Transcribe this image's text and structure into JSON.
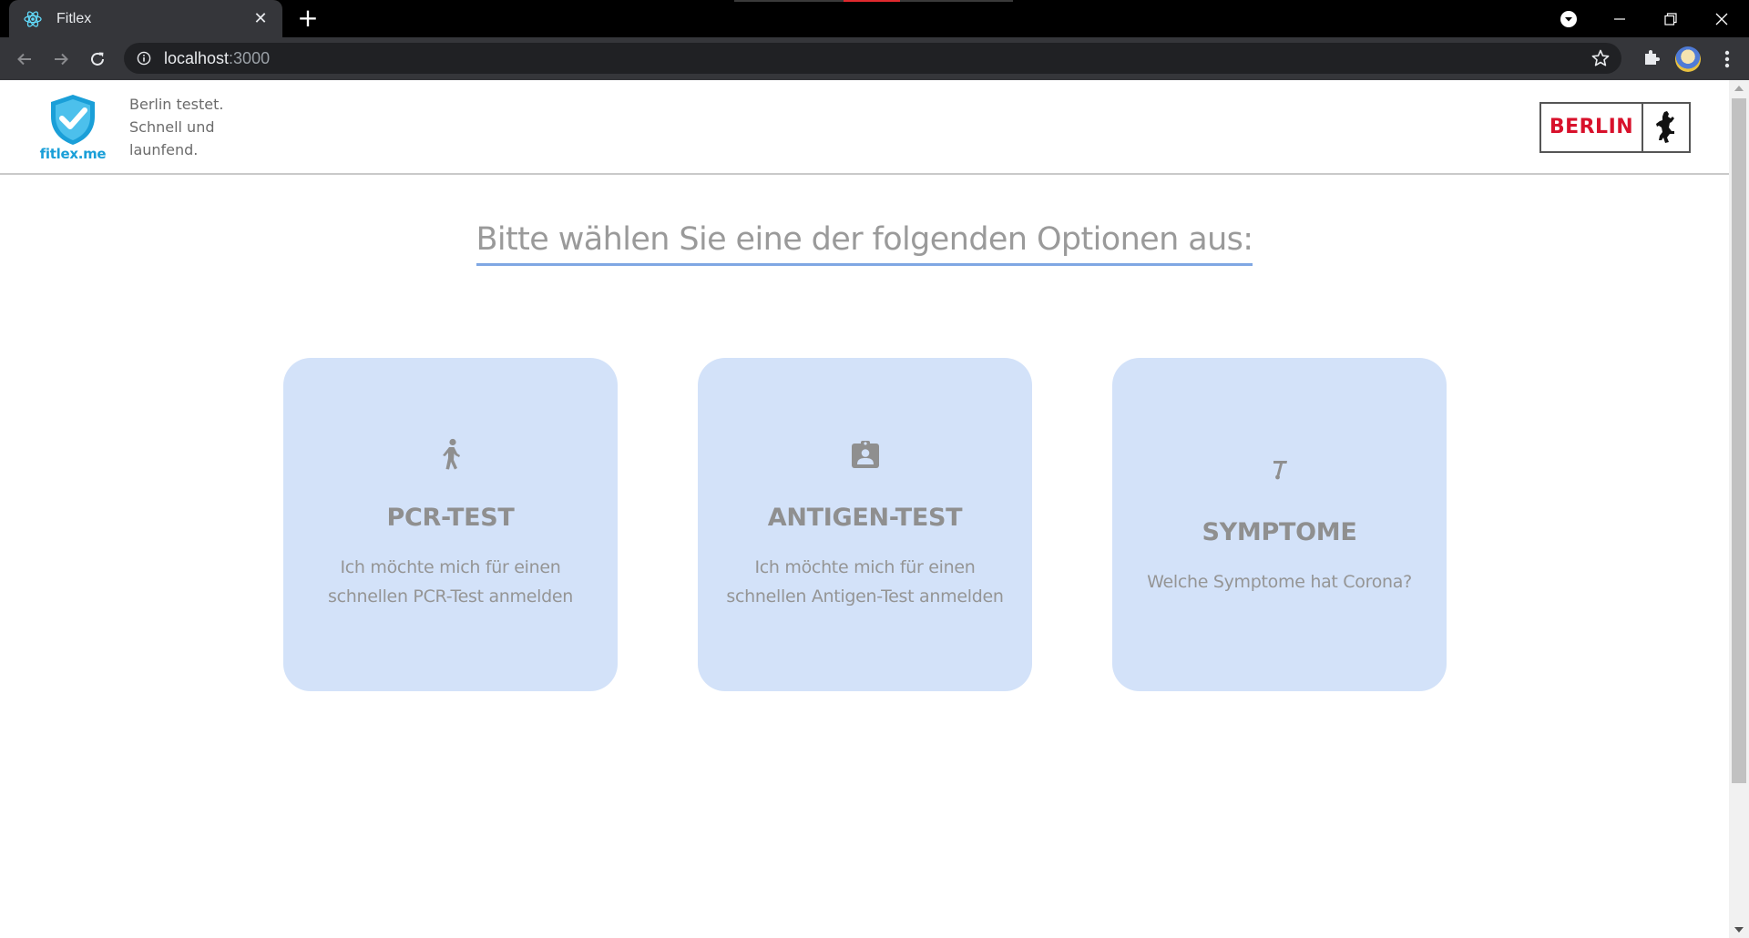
{
  "browser": {
    "tab_title": "Fitlex",
    "url_host": "localhost",
    "url_port": ":3000",
    "icons": {
      "tab": "react-atom-icon",
      "close": "close-icon",
      "new_tab": "plus-icon",
      "back": "arrow-left-icon",
      "forward": "arrow-right-icon",
      "reload": "reload-icon",
      "site_info": "info-icon",
      "bookmark": "star-icon",
      "extensions": "puzzle-icon",
      "menu": "kebab-menu-icon"
    },
    "new_tab_glyph": "+",
    "close_glyph": "✕"
  },
  "header": {
    "logo_text": "fitlex.me",
    "tagline_lines": [
      "Berlin testet.",
      "Schnell und",
      "launfend."
    ],
    "badge_text": "BERLIN",
    "colors": {
      "logo": "#1a9fd8",
      "badge": "#d8112b"
    }
  },
  "main": {
    "headline": "Bitte wählen Sie eine der folgenden Optionen aus:",
    "cards": [
      {
        "icon": "walking-person-icon",
        "title": "PCR-TEST",
        "desc": "Ich möchte mich für einen schnellen PCR-Test anmelden"
      },
      {
        "icon": "clipboard-person-icon",
        "title": "ANTIGEN-TEST",
        "desc": "Ich möchte mich für einen schnellen Antigen-Test anmelden"
      },
      {
        "icon": "thermometer-icon",
        "title": "SYMPTOME",
        "desc": "Welche Symptome hat Corona?"
      }
    ],
    "colors": {
      "card_bg": "#d3e2f9",
      "accent_underline": "#7fa7e3"
    }
  }
}
